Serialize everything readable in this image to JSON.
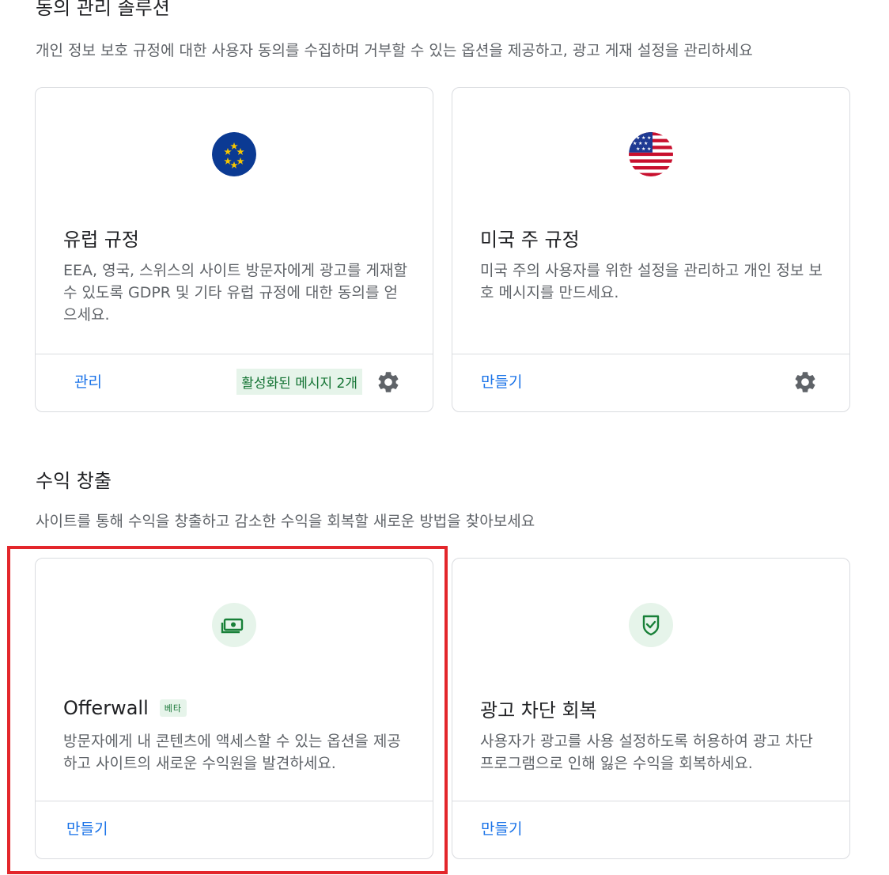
{
  "consent": {
    "title": "동의 관리 솔루션",
    "description": "개인 정보 보호 규정에 대한 사용자 동의를 수집하며 거부할 수 있는 옵션을 제공하고, 광고 게재 설정을 관리하세요",
    "cards": [
      {
        "icon": "eu-flag-icon",
        "title": "유럽 규정",
        "description": "EEA, 영국, 스위스의 사이트 방문자에게 광고를 게재할 수 있도록 GDPR 및 기타 유럽 규정에 대한 동의를 얻으세요.",
        "action_label": "관리",
        "status_badge": "활성화된 메시지 2개",
        "settings_icon": "gear-icon"
      },
      {
        "icon": "us-flag-icon",
        "title": "미국 주 규정",
        "description": "미국 주의 사용자를 위한 설정을 관리하고 개인 정보 보호 메시지를 만드세요.",
        "action_label": "만들기",
        "settings_icon": "gear-icon"
      }
    ]
  },
  "monetization": {
    "title": "수익 창출",
    "description": "사이트를 통해 수익을 창출하고 감소한 수익을 회복할 새로운 방법을 찾아보세요",
    "cards": [
      {
        "icon": "money-icon",
        "title": "Offerwall",
        "badge": "베타",
        "description": "방문자에게 내 콘텐츠에 액세스할 수 있는 옵션을 제공하고 사이트의 새로운 수익원을 발견하세요.",
        "action_label": "만들기"
      },
      {
        "icon": "shield-check-icon",
        "title": "광고 차단 회복",
        "description": "사용자가 광고를 사용 설정하도록 허용하여 광고 차단 프로그램으로 인해 잃은 수익을 회복하세요.",
        "action_label": "만들기"
      }
    ]
  },
  "colors": {
    "link": "#1a73e8",
    "badge_bg": "#e6f4ea",
    "badge_text": "#137333",
    "highlight": "#e3262b"
  }
}
